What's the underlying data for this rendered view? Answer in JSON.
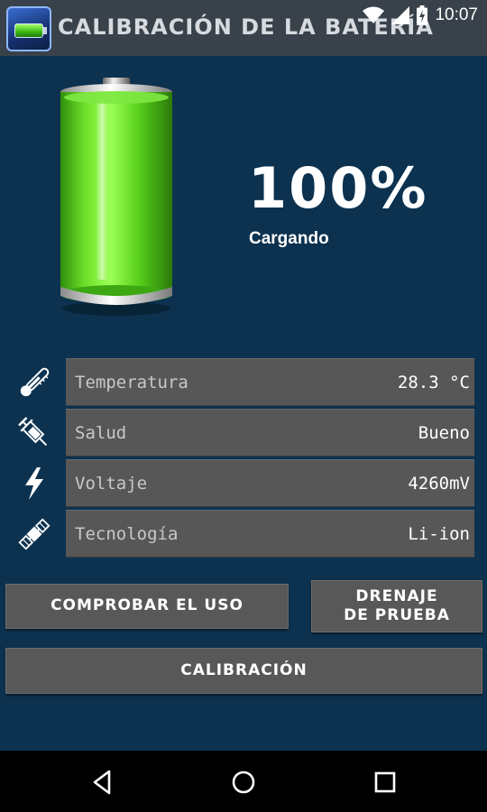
{
  "status_bar": {
    "time": "10:07",
    "icons": [
      "wifi-icon",
      "cellular-signal-icon",
      "battery-charging-icon"
    ]
  },
  "app": {
    "title": "CALIBRACIÓN DE LA BATERÍA",
    "icon": "battery-app-icon"
  },
  "battery": {
    "percent_label": "100%",
    "level": 1.0,
    "status": "Cargando",
    "fill_color": "#4fd61a"
  },
  "info": {
    "rows": [
      {
        "icon": "thermometer-icon",
        "label": "Temperatura",
        "value": "28.3 °C"
      },
      {
        "icon": "syringe-icon",
        "label": "Salud",
        "value": "Bueno"
      },
      {
        "icon": "lightning-bolt-icon",
        "label": "Voltaje",
        "value": "4260mV"
      },
      {
        "icon": "satellite-icon",
        "label": "Tecnología",
        "value": "Li-ion"
      }
    ]
  },
  "buttons": {
    "check_usage": "COMPROBAR EL USO",
    "drain_test_line1": "DRENAJE",
    "drain_test_line2": "DE PRUEBA",
    "calibration": "CALIBRACIÓN"
  },
  "navigation": {
    "back": "back-icon",
    "home": "home-icon",
    "recents": "recents-icon"
  },
  "colors": {
    "background": "#0c3250",
    "app_bar": "#39424a",
    "panel": "#575757",
    "button": "#585858"
  }
}
